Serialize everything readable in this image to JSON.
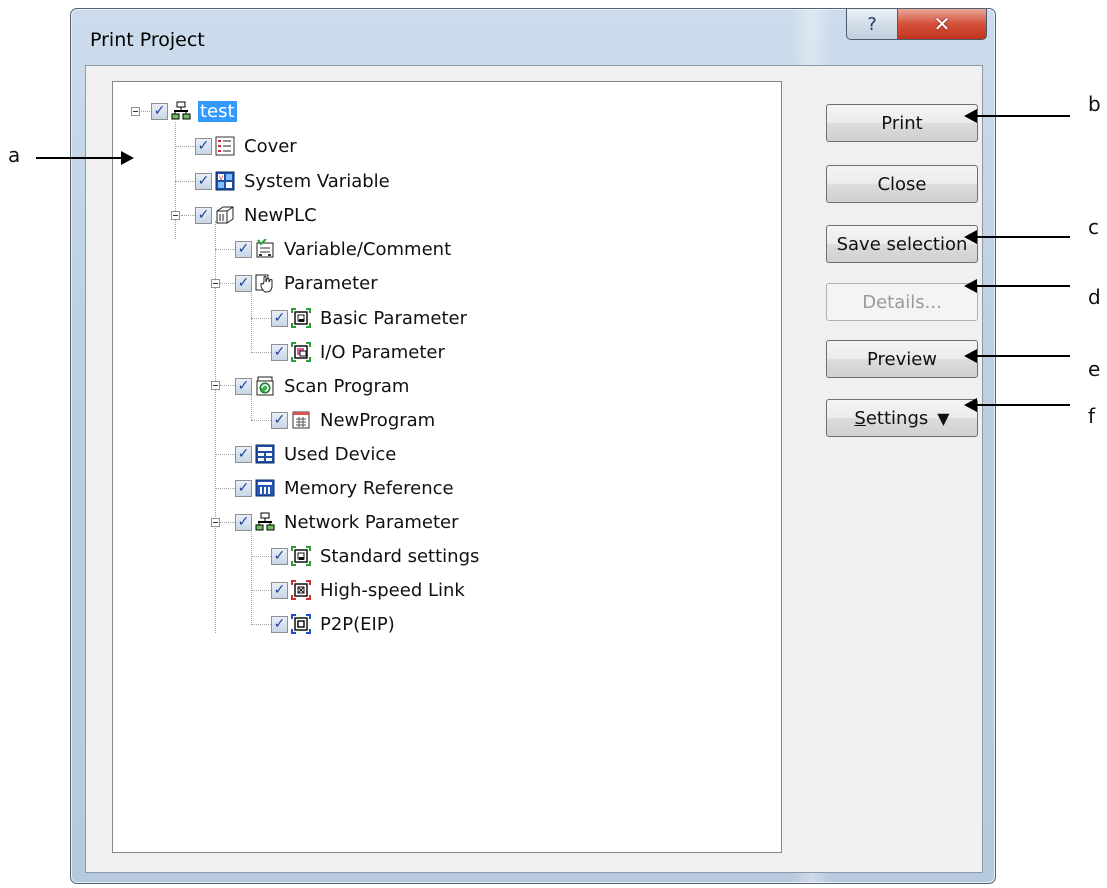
{
  "window": {
    "title": "Print Project",
    "help_glyph": "?",
    "close_glyph": "✕"
  },
  "tree": {
    "check_glyph": "✓",
    "items": [
      {
        "label": "test",
        "icon": "network-project-icon",
        "selected": true
      },
      {
        "label": "Cover",
        "icon": "cover-list-icon"
      },
      {
        "label": "System Variable",
        "icon": "system-variable-icon"
      },
      {
        "label": "NewPLC",
        "icon": "plc-cube-icon"
      },
      {
        "label": "Variable/Comment",
        "icon": "variable-comment-icon"
      },
      {
        "label": "Parameter",
        "icon": "parameter-hand-icon"
      },
      {
        "label": "Basic Parameter",
        "icon": "basic-parameter-icon"
      },
      {
        "label": "I/O Parameter",
        "icon": "io-parameter-icon"
      },
      {
        "label": "Scan Program",
        "icon": "scan-program-icon"
      },
      {
        "label": "NewProgram",
        "icon": "program-icon"
      },
      {
        "label": "Used Device",
        "icon": "used-device-icon"
      },
      {
        "label": "Memory Reference",
        "icon": "memory-reference-icon"
      },
      {
        "label": "Network Parameter",
        "icon": "network-parameter-icon"
      },
      {
        "label": "Standard settings",
        "icon": "standard-settings-icon"
      },
      {
        "label": "High-speed Link",
        "icon": "high-speed-link-icon"
      },
      {
        "label": "P2P(EIP)",
        "icon": "p2p-icon"
      }
    ]
  },
  "buttons": {
    "print": "Print",
    "close": "Close",
    "save_selection": "Save selection",
    "details": "Details...",
    "preview": "Preview",
    "settings_mnemonic": "S",
    "settings_rest": "ettings",
    "settings_arrow": "▼"
  },
  "callouts": {
    "a": "a",
    "b": "b",
    "c": "c",
    "d": "d",
    "e": "e",
    "f": "f"
  }
}
